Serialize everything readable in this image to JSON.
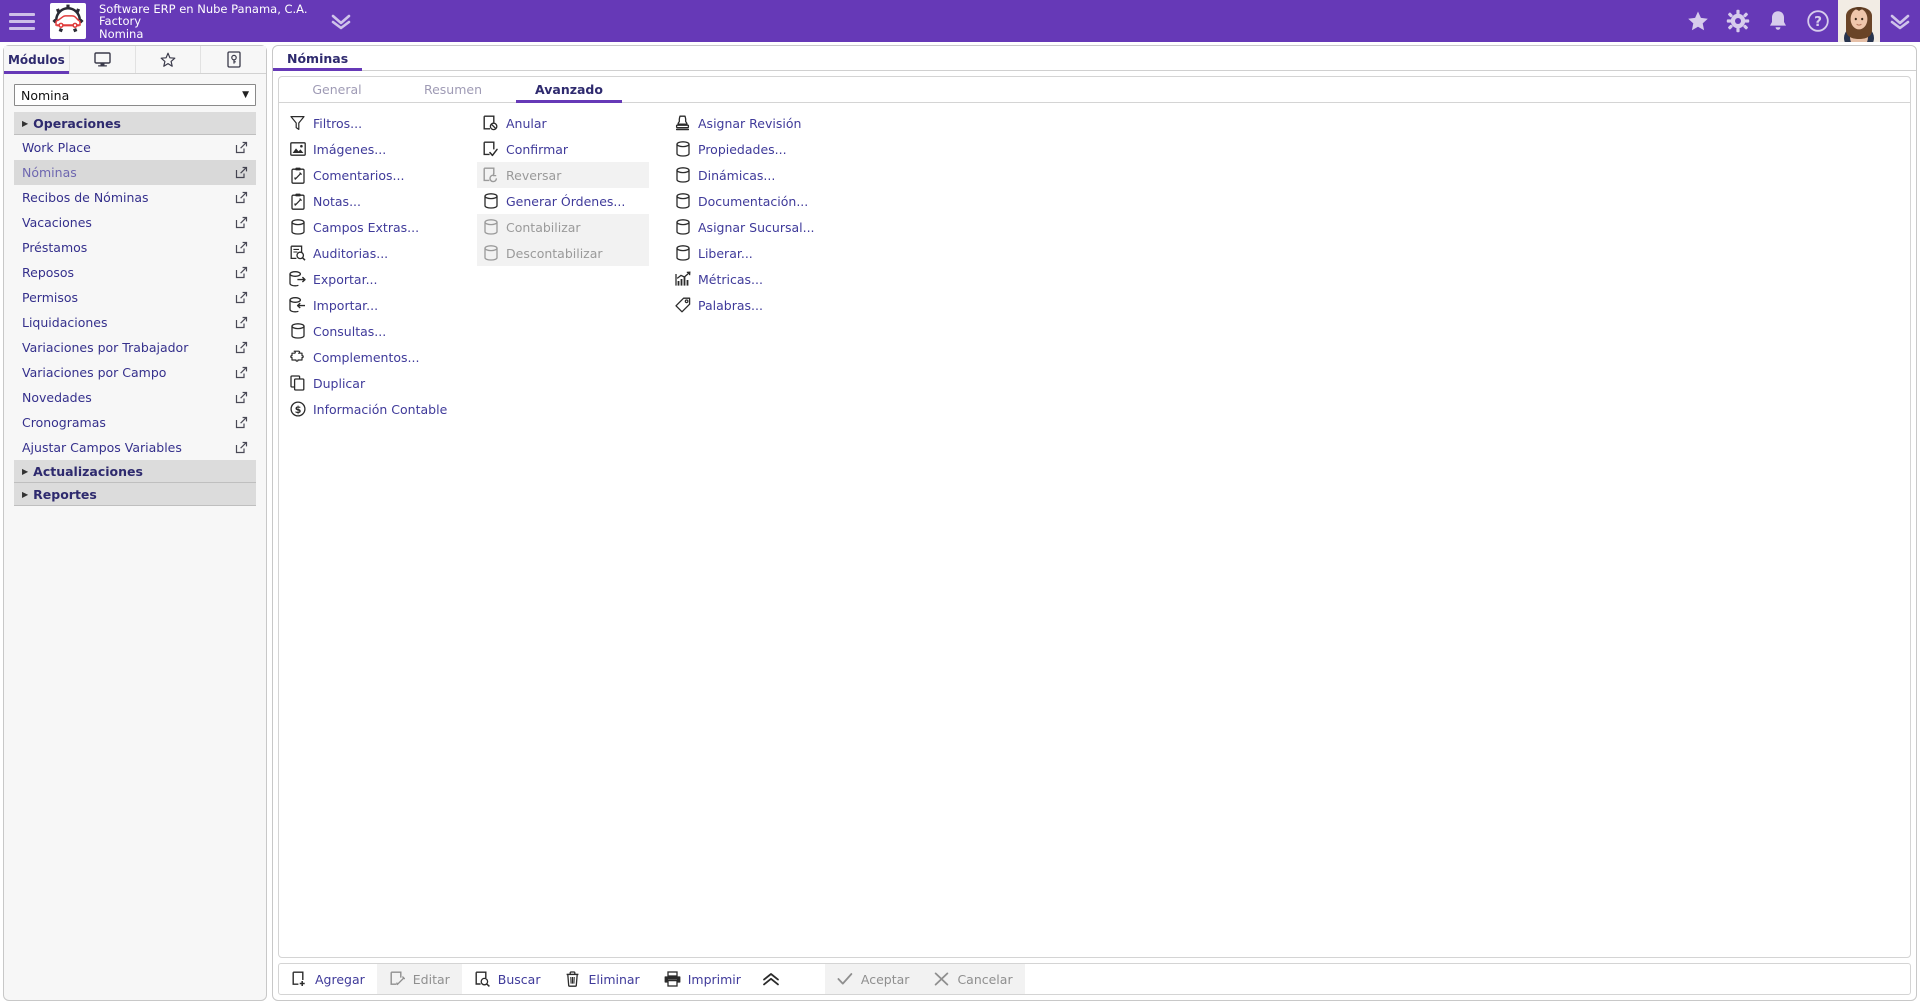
{
  "header": {
    "menu_icon": "hamburger-icon",
    "logo_icon": "company-logo",
    "company": "Software ERP en Nube Panama, C.A.",
    "branch": "Factory",
    "module": "Nomina",
    "brand_chevron_icon": "chevron-down-icon",
    "icons": [
      {
        "name": "favorites-star-icon",
        "glyph": "star"
      },
      {
        "name": "settings-gear-icon",
        "glyph": "gear"
      },
      {
        "name": "notifications-bell-icon",
        "glyph": "bell"
      },
      {
        "name": "help-question-icon",
        "glyph": "question"
      }
    ],
    "avatar_name": "user-avatar",
    "user_chevron_icon": "chevron-down-icon",
    "bar_color": "#6639b7"
  },
  "sidebar": {
    "tabs": [
      {
        "label": "Módulos",
        "name": "sidebar-tab-modulos",
        "icon": null,
        "active": true
      },
      {
        "label": "",
        "name": "sidebar-tab-desktop",
        "icon": "monitor-icon",
        "active": false
      },
      {
        "label": "",
        "name": "sidebar-tab-favorites",
        "icon": "star-icon",
        "active": false
      },
      {
        "label": "",
        "name": "sidebar-tab-keys",
        "icon": "key-document-icon",
        "active": false
      }
    ],
    "module_select": {
      "value": "Nomina",
      "caret_icon": "caret-down-icon"
    },
    "groups": [
      {
        "label": "Operaciones",
        "name": "sidebar-group-operaciones",
        "expanded": true
      },
      {
        "label": "Actualizaciones",
        "name": "sidebar-group-actualizaciones",
        "expanded": false
      },
      {
        "label": "Reportes",
        "name": "sidebar-group-reportes",
        "expanded": false
      }
    ],
    "items": [
      {
        "label": "Work Place",
        "selected": false,
        "ext_icon": "external-link-icon"
      },
      {
        "label": "Nóminas",
        "selected": true,
        "ext_icon": "external-link-icon"
      },
      {
        "label": "Recibos de Nóminas",
        "selected": false,
        "ext_icon": "external-link-icon"
      },
      {
        "label": "Vacaciones",
        "selected": false,
        "ext_icon": "external-link-icon"
      },
      {
        "label": "Préstamos",
        "selected": false,
        "ext_icon": "external-link-icon"
      },
      {
        "label": "Reposos",
        "selected": false,
        "ext_icon": "external-link-icon"
      },
      {
        "label": "Permisos",
        "selected": false,
        "ext_icon": "external-link-icon"
      },
      {
        "label": "Liquidaciones",
        "selected": false,
        "ext_icon": "external-link-icon"
      },
      {
        "label": "Variaciones por Trabajador",
        "selected": false,
        "ext_icon": "external-link-icon"
      },
      {
        "label": "Variaciones por Campo",
        "selected": false,
        "ext_icon": "external-link-icon"
      },
      {
        "label": "Novedades",
        "selected": false,
        "ext_icon": "external-link-icon"
      },
      {
        "label": "Cronogramas",
        "selected": false,
        "ext_icon": "external-link-icon"
      },
      {
        "label": "Ajustar Campos Variables",
        "selected": false,
        "ext_icon": "external-link-icon"
      }
    ]
  },
  "main": {
    "window_tab": "Nóminas",
    "sub_tabs": [
      {
        "label": "General",
        "active": false
      },
      {
        "label": "Resumen",
        "active": false
      },
      {
        "label": "Avanzado",
        "active": true
      }
    ],
    "column1": [
      {
        "label": "Filtros...",
        "icon": "funnel-icon",
        "disabled": false
      },
      {
        "label": "Imágenes...",
        "icon": "image-icon",
        "disabled": false
      },
      {
        "label": "Comentarios...",
        "icon": "clipboard-pencil-icon",
        "disabled": false
      },
      {
        "label": "Notas...",
        "icon": "clipboard-pencil-icon",
        "disabled": false
      },
      {
        "label": "Campos Extras...",
        "icon": "database-icon",
        "disabled": false
      },
      {
        "label": "Auditorias...",
        "icon": "audit-search-icon",
        "disabled": false
      },
      {
        "label": "Exportar...",
        "icon": "database-export-icon",
        "disabled": false
      },
      {
        "label": "Importar...",
        "icon": "database-import-icon",
        "disabled": false
      },
      {
        "label": "Consultas...",
        "icon": "database-icon",
        "disabled": false
      },
      {
        "label": "Complementos...",
        "icon": "puzzle-icon",
        "disabled": false
      },
      {
        "label": "Duplicar",
        "icon": "copy-icon",
        "disabled": false
      },
      {
        "label": "Información Contable",
        "icon": "dollar-circle-icon",
        "disabled": false
      }
    ],
    "column2": [
      {
        "label": "Anular",
        "icon": "page-cancel-icon",
        "disabled": false
      },
      {
        "label": "Confirmar",
        "icon": "page-check-icon",
        "disabled": false
      },
      {
        "label": "Reversar",
        "icon": "page-revert-icon",
        "disabled": true
      },
      {
        "label": "Generar Órdenes...",
        "icon": "database-icon",
        "disabled": false
      },
      {
        "label": "Contabilizar",
        "icon": "database-icon",
        "disabled": true
      },
      {
        "label": "Descontabilizar",
        "icon": "database-icon",
        "disabled": true
      }
    ],
    "column3": [
      {
        "label": "Asignar Revisión",
        "icon": "stamp-icon",
        "disabled": false
      },
      {
        "label": "Propiedades...",
        "icon": "database-icon",
        "disabled": false
      },
      {
        "label": "Dinámicas...",
        "icon": "database-icon",
        "disabled": false
      },
      {
        "label": "Documentación...",
        "icon": "database-icon",
        "disabled": false
      },
      {
        "label": "Asignar Sucursal...",
        "icon": "database-icon",
        "disabled": false
      },
      {
        "label": "Liberar...",
        "icon": "database-icon",
        "disabled": false
      },
      {
        "label": "Métricas...",
        "icon": "chart-growth-icon",
        "disabled": false
      },
      {
        "label": "Palabras...",
        "icon": "tag-icon",
        "disabled": false
      }
    ]
  },
  "bottombar": {
    "left": [
      {
        "label": "Agregar",
        "icon": "page-add-icon",
        "disabled": false
      },
      {
        "label": "Editar",
        "icon": "page-edit-icon",
        "disabled": true
      },
      {
        "label": "Buscar",
        "icon": "page-search-icon",
        "disabled": false
      },
      {
        "label": "Eliminar",
        "icon": "trash-icon",
        "disabled": false
      },
      {
        "label": "Imprimir",
        "icon": "printer-icon",
        "disabled": false
      }
    ],
    "collapse_icon": "chevron-up-double-icon",
    "right": [
      {
        "label": "Aceptar",
        "icon": "check-icon",
        "disabled": true
      },
      {
        "label": "Cancelar",
        "icon": "x-icon",
        "disabled": true
      }
    ]
  }
}
